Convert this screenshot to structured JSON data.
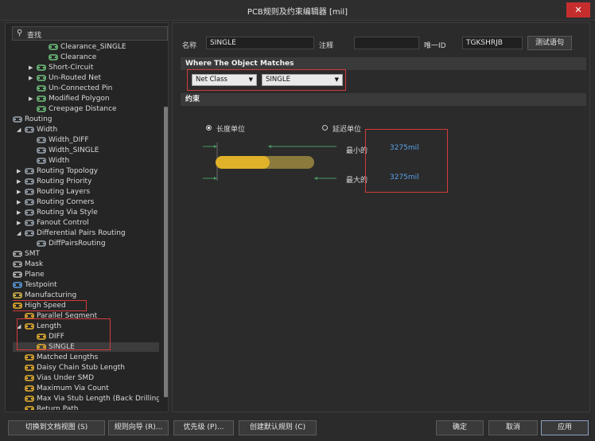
{
  "window": {
    "title": "PCB规则及约束编辑器 [mil]",
    "close_glyph": "✕"
  },
  "search": {
    "icon": "magnifier-icon",
    "placeholder": "查找"
  },
  "tree": [
    {
      "label": "Clearance_SINGLE",
      "icon": "rule-icon"
    },
    {
      "label": "Clearance",
      "icon": "rule-icon"
    },
    {
      "label": "Short-Circuit",
      "icon": "rule-icon"
    },
    {
      "label": "Un-Routed Net",
      "icon": "rule-icon"
    },
    {
      "label": "Un-Connected Pin",
      "icon": "rule-icon"
    },
    {
      "label": "Modified Polygon",
      "icon": "rule-icon"
    },
    {
      "label": "Creepage Distance",
      "icon": "rule-icon"
    },
    {
      "label": "Routing",
      "icon": "routing-icon"
    },
    {
      "label": "Width",
      "icon": "routing-icon"
    },
    {
      "label": "Width_DIFF",
      "icon": "routing-icon"
    },
    {
      "label": "Width_SINGLE",
      "icon": "routing-icon"
    },
    {
      "label": "Width",
      "icon": "routing-icon"
    },
    {
      "label": "Routing Topology",
      "icon": "routing-icon"
    },
    {
      "label": "Routing Priority",
      "icon": "routing-icon"
    },
    {
      "label": "Routing Layers",
      "icon": "routing-icon"
    },
    {
      "label": "Routing Corners",
      "icon": "routing-icon"
    },
    {
      "label": "Routing Via Style",
      "icon": "routing-icon"
    },
    {
      "label": "Fanout Control",
      "icon": "routing-icon"
    },
    {
      "label": "Differential Pairs Routing",
      "icon": "routing-icon"
    },
    {
      "label": "DiffPairsRouting",
      "icon": "routing-icon"
    },
    {
      "label": "SMT",
      "icon": "smt-icon"
    },
    {
      "label": "Mask",
      "icon": "mask-icon"
    },
    {
      "label": "Plane",
      "icon": "plane-icon"
    },
    {
      "label": "Testpoint",
      "icon": "testpoint-icon"
    },
    {
      "label": "Manufacturing",
      "icon": "manufacturing-icon"
    },
    {
      "label": "High Speed",
      "icon": "highspeed-icon"
    },
    {
      "label": "Parallel Segment",
      "icon": "highspeed-icon"
    },
    {
      "label": "Length",
      "icon": "highspeed-icon"
    },
    {
      "label": "DIFF",
      "icon": "highspeed-icon"
    },
    {
      "label": "SINGLE",
      "icon": "highspeed-icon"
    },
    {
      "label": "Matched Lengths",
      "icon": "highspeed-icon"
    },
    {
      "label": "Daisy Chain Stub Length",
      "icon": "highspeed-icon"
    },
    {
      "label": "Vias Under SMD",
      "icon": "highspeed-icon"
    },
    {
      "label": "Maximum Via Count",
      "icon": "highspeed-icon"
    },
    {
      "label": "Max Via Stub Length (Back Drilling)",
      "icon": "highspeed-icon"
    },
    {
      "label": "Return Path",
      "icon": "highspeed-icon"
    }
  ],
  "rule": {
    "name_label": "名称",
    "name_value": "SINGLE",
    "comment_label": "注释",
    "comment_value": "",
    "uid_label": "唯一ID",
    "uid_value": "TGKSHRJB",
    "test_button": "测试语句"
  },
  "where": {
    "header": "Where The Object Matches",
    "type_value": "Net Class",
    "class_value": "SINGLE"
  },
  "constraints": {
    "header": "约束",
    "radio_length": "长度单位",
    "radio_delay": "延迟单位",
    "min_label": "最小的",
    "min_value": "3275mil",
    "max_label": "最大的",
    "max_value": "3275mil"
  },
  "footer": {
    "switch_view": "切换到文档视图 (S)",
    "rule_wizard": "规则向导 (R)...",
    "priority": "优先级 (P)...",
    "create_default": "创建默认规则 (C)",
    "ok": "确定",
    "cancel": "取消",
    "apply": "应用"
  },
  "colors": {
    "accent_red": "#d43b3b",
    "link_blue": "#5aa0e6",
    "bar_yellow": "#e0b22a"
  }
}
